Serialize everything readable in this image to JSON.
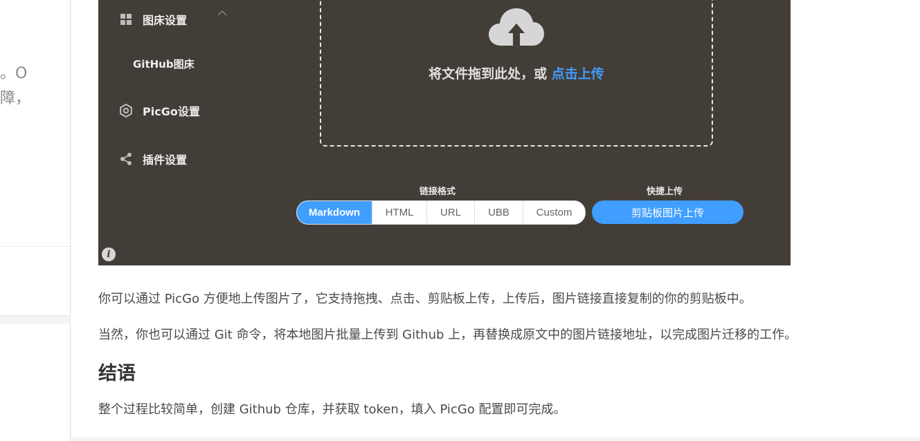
{
  "sidebar": {
    "snippet_line1": "成。O",
    "snippet_line2": "保障，"
  },
  "picgo": {
    "nav": [
      {
        "label": "图床设置",
        "icon": "grid-icon"
      },
      {
        "label": "GitHub图床"
      },
      {
        "label": "PicGo设置",
        "icon": "gear-icon"
      },
      {
        "label": "插件设置",
        "icon": "share-icon"
      }
    ],
    "drop_text": "将文件拖到此处，或 ",
    "drop_link": "点击上传",
    "link_format_label": "链接格式",
    "formats": [
      "Markdown",
      "HTML",
      "URL",
      "UBB",
      "Custom"
    ],
    "quick_upload_label": "快捷上传",
    "clipboard_button": "剪贴板图片上传",
    "info_glyph": "i"
  },
  "article": {
    "p1": "你可以通过 PicGo 方便地上传图片了，它支持拖拽、点击、剪贴板上传，上传后，图片链接直接复制的你的剪贴板中。",
    "p2": "当然，你也可以通过 Git 命令，将本地图片批量上传到 Github 上，再替换成原文中的图片链接地址，以完成图片迁移的工作。",
    "heading": "结语",
    "p3": "整个过程比较简单，创建 Github 仓库，并获取 token，填入 PicGo 配置即可完成。"
  },
  "colors": {
    "accent": "#409eff",
    "picgo_bg": "#433d38"
  }
}
